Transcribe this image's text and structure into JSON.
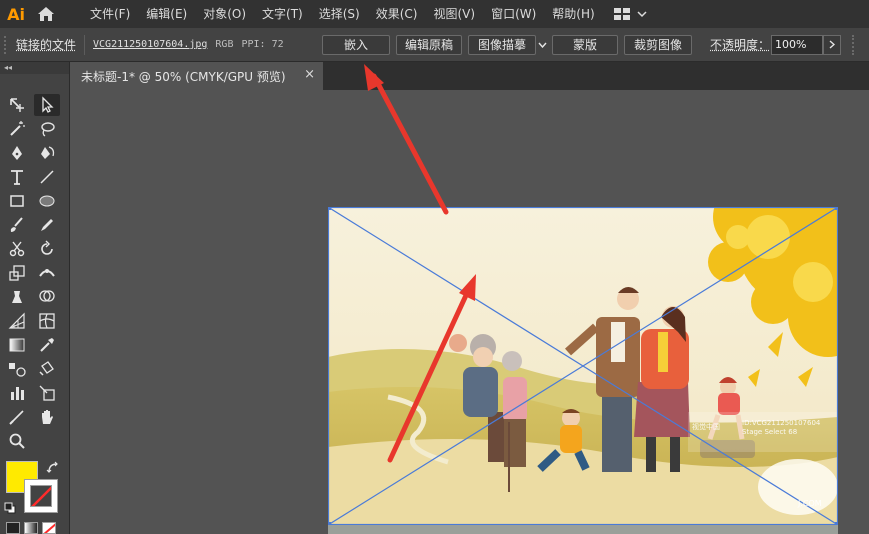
{
  "app": {
    "logo": "Ai"
  },
  "menu": [
    "文件(F)",
    "编辑(E)",
    "对象(O)",
    "文字(T)",
    "选择(S)",
    "效果(C)",
    "视图(V)",
    "窗口(W)",
    "帮助(H)"
  ],
  "control_bar": {
    "linked_file_label": "链接的文件",
    "filename": "VCG211250107604.jpg",
    "color_mode": "RGB",
    "ppi": "PPI: 72",
    "embed_button": "嵌入",
    "edit_original_button": "编辑原稿",
    "image_trace_button": "图像描摹",
    "mask_button": "蒙版",
    "crop_image_button": "裁剪图像",
    "opacity_label": "不透明度：",
    "opacity_value": "100%"
  },
  "document_tab": {
    "label": "未标题-1* @ 50% (CMYK/GPU 预览)",
    "close": "×"
  },
  "watermark": {
    "brand": "视觉中国",
    "id": "ID:VCG211250107604",
    "sub": "Stage Select 68",
    "site": "J.COM"
  },
  "colors": {
    "accent": "#ff9a00",
    "fill_swatch": "#ffea00",
    "arrow": "#e8372c",
    "bounding_box": "#4a7bd8"
  },
  "icons": [
    "home-icon",
    "workspace-switcher-icon",
    "chevron-down-icon",
    "chevron-right-icon",
    "swap-icon",
    "default-colors-icon"
  ]
}
